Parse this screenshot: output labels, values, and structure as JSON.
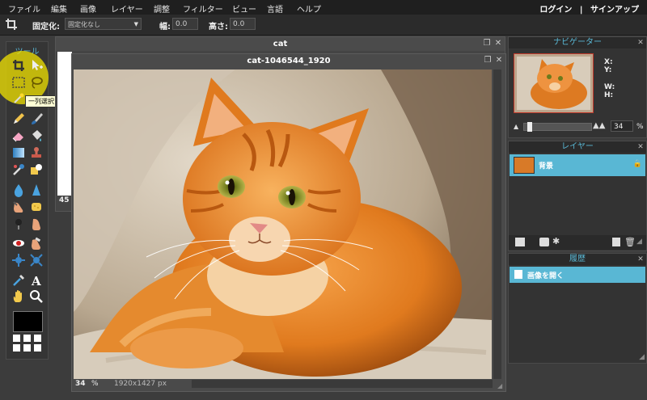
{
  "menu": {
    "items": [
      "ファイル",
      "編集",
      "画像",
      "レイヤー",
      "調整",
      "フィルター",
      "ビュー",
      "言語",
      "ヘルプ"
    ],
    "login": "ログイン",
    "separator": "|",
    "signup": "サインアップ"
  },
  "options": {
    "fixed_label": "固定化:",
    "fixed_value": "固定化なし",
    "width_label": "幅:",
    "width_value": "0.0",
    "height_label": "高さ:",
    "height_value": "0.0"
  },
  "tools": {
    "title": "ツール",
    "tooltip": "一列選択ツール（M）",
    "items": [
      "crop-icon",
      "move-icon",
      "marquee-icon",
      "lasso-icon",
      "wand-icon",
      "",
      "pencil-icon",
      "brush-icon",
      "eraser-icon",
      "bucket-icon",
      "gradient-icon",
      "stamp-icon",
      "color-replace-icon",
      "draw-shape-icon",
      "blur-icon",
      "sharpen-icon",
      "smudge-icon",
      "sponge-icon",
      "burn-icon",
      "dodge-icon",
      "red-eye-icon",
      "spot-heal-icon",
      "bloat-icon",
      "pinch-icon",
      "color-picker-icon",
      "type-icon",
      "hand-icon",
      "zoom-icon"
    ]
  },
  "back_window": {
    "title": "cat",
    "zoom": "45"
  },
  "front_window": {
    "title": "cat-1046544_1920",
    "zoom": "34",
    "zoom_unit": "%",
    "size": "1920x1427 px"
  },
  "navigator": {
    "title": "ナビゲーター",
    "x_label": "X:",
    "y_label": "Y:",
    "w_label": "W:",
    "h_label": "H:",
    "zoom": "34",
    "zoom_unit": "%",
    "zoom_level": 0.05
  },
  "layers": {
    "title": "レイヤー",
    "items": [
      {
        "name": "背景"
      }
    ]
  },
  "history": {
    "title": "履歴",
    "items": [
      {
        "name": "画像を開く"
      }
    ]
  },
  "colors": {
    "accent": "#59b7d4",
    "tooltip_bg": "#ffffd6",
    "highlight": "#f2e300"
  }
}
